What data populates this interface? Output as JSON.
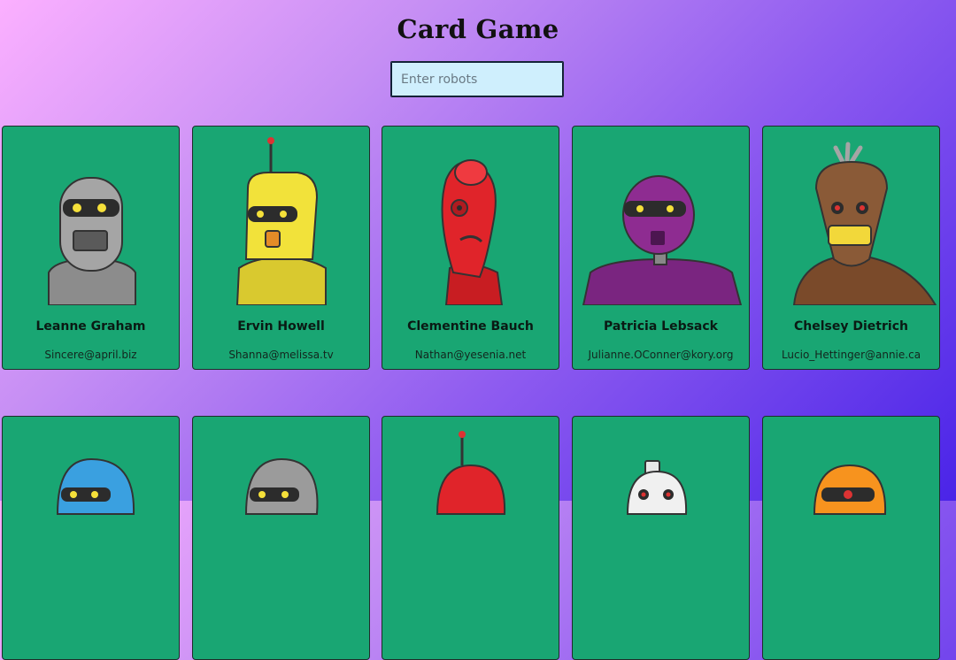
{
  "header": {
    "title": "Card Game"
  },
  "search": {
    "placeholder": "Enter robots"
  },
  "robots": [
    {
      "name": "Leanne Graham",
      "email": "Sincere@april.biz",
      "color": "#9a9a9a",
      "icon": "silver-robot-icon"
    },
    {
      "name": "Ervin Howell",
      "email": "Shanna@melissa.tv",
      "color": "#f2e23a",
      "icon": "yellow-robot-icon"
    },
    {
      "name": "Clementine Bauch",
      "email": "Nathan@yesenia.net",
      "color": "#e0242a",
      "icon": "red-robot-icon"
    },
    {
      "name": "Patricia Lebsack",
      "email": "Julianne.OConner@kory.org",
      "color": "#8e2c91",
      "icon": "purple-robot-icon"
    },
    {
      "name": "Chelsey Dietrich",
      "email": "Lucio_Hettinger@annie.ca",
      "color": "#8a5a37",
      "icon": "brown-robot-icon"
    },
    {
      "name": "",
      "email": "",
      "color": "#3aa0e0",
      "icon": "blue-robot-icon"
    },
    {
      "name": "",
      "email": "",
      "color": "#9b9b9b",
      "icon": "gray-robot-icon"
    },
    {
      "name": "",
      "email": "",
      "color": "#e0242a",
      "icon": "red-robot-icon"
    },
    {
      "name": "",
      "email": "",
      "color": "#f0f0f0",
      "icon": "white-robot-icon"
    },
    {
      "name": "",
      "email": "",
      "color": "#f7931e",
      "icon": "orange-robot-icon"
    }
  ]
}
